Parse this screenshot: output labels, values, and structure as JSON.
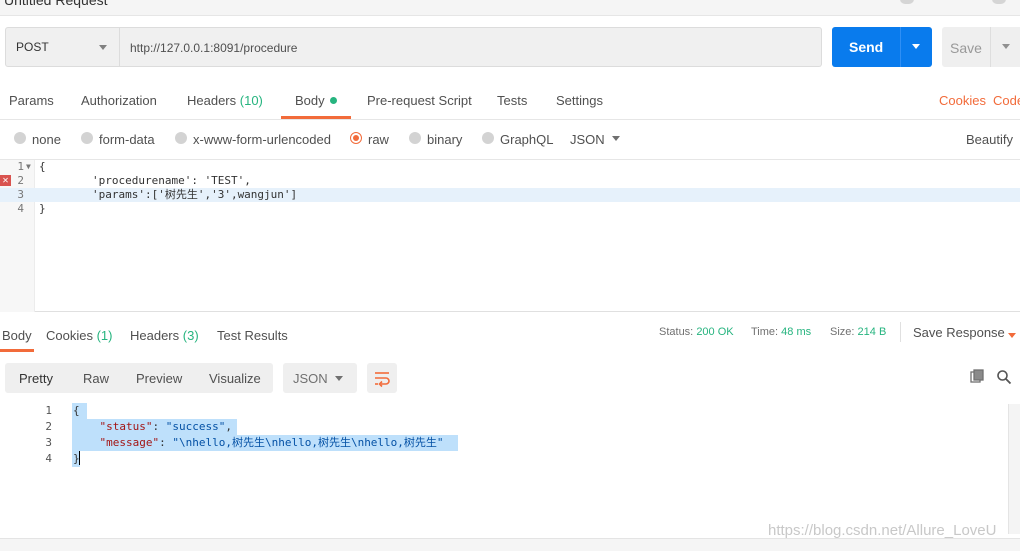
{
  "window": {
    "title": "Untitled Request"
  },
  "request": {
    "method": "POST",
    "url": "http://127.0.0.1:8091/procedure",
    "send_label": "Send",
    "save_label": "Save"
  },
  "req_tabs": {
    "params": "Params",
    "authorization": "Authorization",
    "headers": "Headers",
    "headers_count": "(10)",
    "body": "Body",
    "prerequest": "Pre-request Script",
    "tests": "Tests",
    "settings": "Settings",
    "cookies": "Cookies",
    "code": "Code"
  },
  "body_options": {
    "none": "none",
    "form_data": "form-data",
    "urlencoded": "x-www-form-urlencoded",
    "raw": "raw",
    "binary": "binary",
    "graphql": "GraphQL",
    "format": "JSON",
    "beautify": "Beautify",
    "selected": "raw"
  },
  "request_body": {
    "lines": [
      {
        "num": "1",
        "text": "{"
      },
      {
        "num": "2",
        "text": "        'procedurename': 'TEST',"
      },
      {
        "num": "3",
        "text": "        'params':['树先生','3',wangjun']"
      },
      {
        "num": "4",
        "text": "}"
      }
    ]
  },
  "response": {
    "tabs": {
      "body": "Body",
      "cookies": "Cookies",
      "cookies_count": "(1)",
      "headers": "Headers",
      "headers_count": "(3)",
      "test_results": "Test Results"
    },
    "status_label": "Status:",
    "status_value": "200 OK",
    "time_label": "Time:",
    "time_value": "48 ms",
    "size_label": "Size:",
    "size_value": "214 B",
    "save_response": "Save Response",
    "views": {
      "pretty": "Pretty",
      "raw": "Raw",
      "preview": "Preview",
      "visualize": "Visualize",
      "format": "JSON"
    },
    "line_numbers": [
      "1",
      "2",
      "3",
      "4"
    ],
    "json": {
      "open": "{",
      "status_key": "\"status\"",
      "status_val": "\"success\"",
      "message_key": "\"message\"",
      "message_val": "\"\\nhello,树先生\\nhello,树先生\\nhello,树先生\"",
      "close": "}"
    }
  },
  "watermark": "https://blog.csdn.net/Allure_LoveU",
  "colors": {
    "accent": "#f26b3a",
    "send": "#097bed",
    "success": "#26b47f",
    "selection": "#bee0fb"
  }
}
